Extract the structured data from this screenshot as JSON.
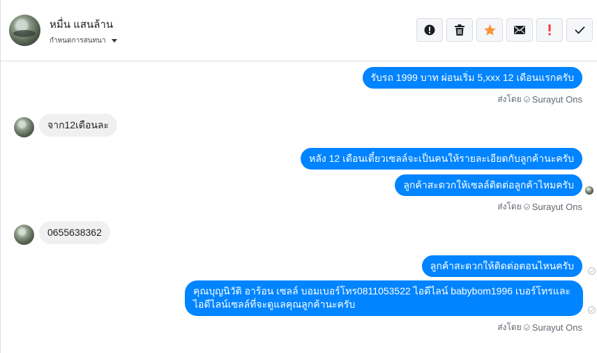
{
  "header": {
    "contact_name": "หมื่น แสนล้าน",
    "assign_label": "กำหนดการสนทนา"
  },
  "actions": [
    {
      "name": "mark-spam-button",
      "icon": "alert-circle-icon"
    },
    {
      "name": "delete-button",
      "icon": "trash-icon"
    },
    {
      "name": "star-button",
      "icon": "star-icon"
    },
    {
      "name": "mark-unread-button",
      "icon": "envelope-icon"
    },
    {
      "name": "follow-up-button",
      "icon": "exclamation-icon"
    },
    {
      "name": "mark-done-button",
      "icon": "checkmark-icon"
    }
  ],
  "messages": {
    "m1": "รับรถ 1999 บาท ผ่อนเริ่ม 5,xxx 12 เดือนแรกครับ",
    "m2": "จาก12เดือนละ",
    "m3": "หลัง 12 เดือนเดี๋ยวเซลล์จะเป็นคนให้รายละเอียดกับลูกค้านะครับ",
    "m4": "ลูกค้าสะดวกให้เซลล์ติดต่อลูกค้าไหมครับ",
    "m5": "0655638362",
    "m6": "ลูกค้าสะดวกให้ติดต่อตอนไหนครับ",
    "m7": "คุณบุญนิวัติ อาร้อน เซลล์ บอมเบอร์โทร0811053522 ไอดีไลน์ babybom1996  เบอร์โทรและไอดีไลน์เซลล์ที่จะดูแลคุณลูกค้านะครับ"
  },
  "sent_by": {
    "prefix": "ส่งโดย",
    "agent": "Surayut Ons"
  },
  "colors": {
    "outgoing_bubble": "#0084ff",
    "incoming_bubble": "#f1f0f0",
    "star": "#f7923a",
    "follow_up": "#fa383e"
  }
}
